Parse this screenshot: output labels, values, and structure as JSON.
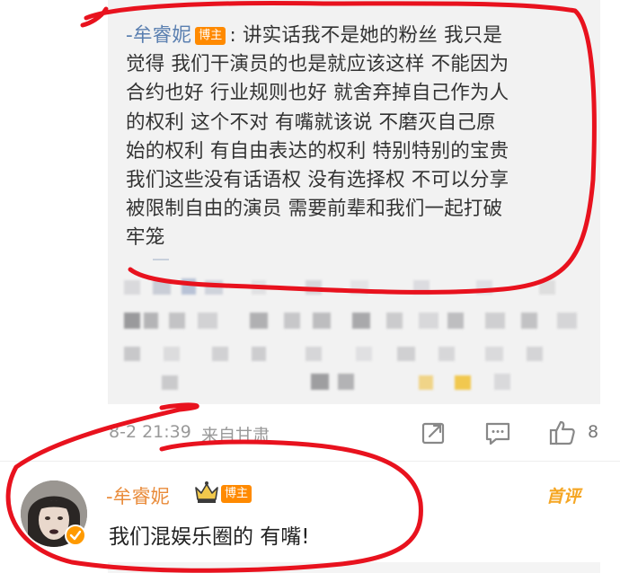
{
  "quoted_reply": {
    "author": "-牟睿妮",
    "badge": "博主",
    "colon": ": ",
    "lines": [
      "讲实话我不是她的粉丝 我只是",
      "觉得 我们干演员的也是就应该这样 不能因为",
      "合约也好 行业规则也好 就舍弃掉自己作为人",
      "的权利 这个不对 有嘴就该说 不磨灭自己原",
      "始的权利 有自由表达的权利 特别特别的宝贵",
      "我们这些没有话语权 没有选择权 不可以分享",
      "被限制自由的演员 需要前辈和我们一起打破",
      "牢笼"
    ]
  },
  "meta": {
    "time": "8-2 21:39",
    "location": "来自甘肃",
    "like_count": "8"
  },
  "comment": {
    "author": "-牟睿妮",
    "badge": "博主",
    "tag": "首评",
    "text": "我们混娱乐圈的 有嘴!"
  },
  "icons": {
    "share": "share-icon",
    "comment": "comment-icon",
    "like": "thumbs-up-icon",
    "crown": "crown-icon",
    "verified": "verified-icon"
  },
  "colors": {
    "author_link": "#5a7fb0",
    "badge": "#ff8a00",
    "comment_author": "#e98b3a",
    "first_comment": "#f5a623",
    "annotation": "#e8121e"
  }
}
